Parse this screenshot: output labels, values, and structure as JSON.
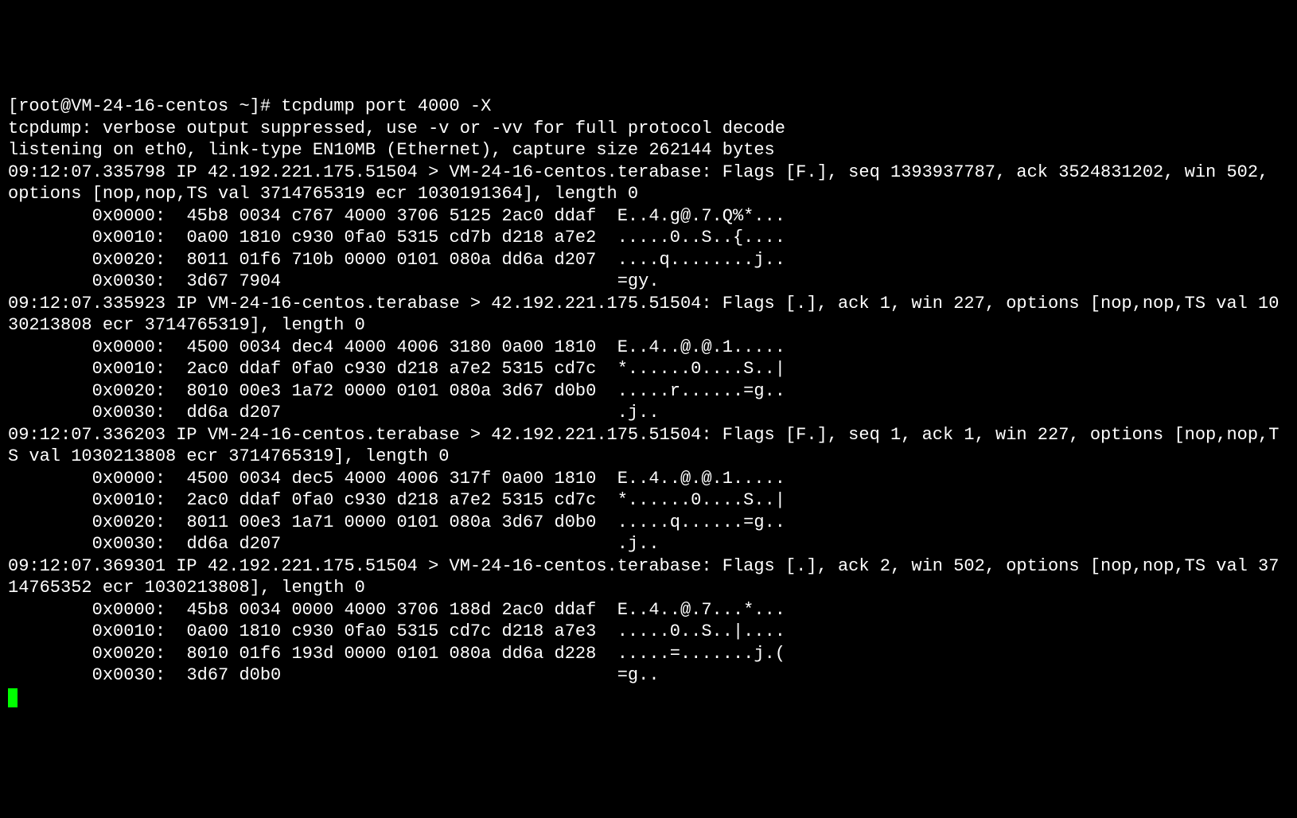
{
  "prompt": {
    "prefix": "[root@VM-24-16-centos ~]# ",
    "command": "tcpdump port 4000 -X"
  },
  "header1": "tcpdump: verbose output suppressed, use -v or -vv for full protocol decode",
  "header2": "listening on eth0, link-type EN10MB (Ethernet), capture size 262144 bytes",
  "packets": [
    {
      "summary": "09:12:07.335798 IP 42.192.221.175.51504 > VM-24-16-centos.terabase: Flags [F.], seq 1393937787, ack 3524831202, win 502, options [nop,nop,TS val 3714765319 ecr 1030191364], length 0",
      "hex": [
        "        0x0000:  45b8 0034 c767 4000 3706 5125 2ac0 ddaf  E..4.g@.7.Q%*...",
        "        0x0010:  0a00 1810 c930 0fa0 5315 cd7b d218 a7e2  .....0..S..{....",
        "        0x0020:  8011 01f6 710b 0000 0101 080a dd6a d207  ....q........j..",
        "        0x0030:  3d67 7904                                =gy."
      ]
    },
    {
      "summary": "09:12:07.335923 IP VM-24-16-centos.terabase > 42.192.221.175.51504: Flags [.], ack 1, win 227, options [nop,nop,TS val 1030213808 ecr 3714765319], length 0",
      "hex": [
        "        0x0000:  4500 0034 dec4 4000 4006 3180 0a00 1810  E..4..@.@.1.....",
        "        0x0010:  2ac0 ddaf 0fa0 c930 d218 a7e2 5315 cd7c  *......0....S..|",
        "        0x0020:  8010 00e3 1a72 0000 0101 080a 3d67 d0b0  .....r......=g..",
        "        0x0030:  dd6a d207                                .j.."
      ]
    },
    {
      "summary": "09:12:07.336203 IP VM-24-16-centos.terabase > 42.192.221.175.51504: Flags [F.], seq 1, ack 1, win 227, options [nop,nop,TS val 1030213808 ecr 3714765319], length 0",
      "hex": [
        "        0x0000:  4500 0034 dec5 4000 4006 317f 0a00 1810  E..4..@.@.1.....",
        "        0x0010:  2ac0 ddaf 0fa0 c930 d218 a7e2 5315 cd7c  *......0....S..|",
        "        0x0020:  8011 00e3 1a71 0000 0101 080a 3d67 d0b0  .....q......=g..",
        "        0x0030:  dd6a d207                                .j.."
      ]
    },
    {
      "summary": "09:12:07.369301 IP 42.192.221.175.51504 > VM-24-16-centos.terabase: Flags [.], ack 2, win 502, options [nop,nop,TS val 3714765352 ecr 1030213808], length 0",
      "hex": [
        "        0x0000:  45b8 0034 0000 4000 3706 188d 2ac0 ddaf  E..4..@.7...*...",
        "        0x0010:  0a00 1810 c930 0fa0 5315 cd7c d218 a7e3  .....0..S..|....",
        "        0x0020:  8010 01f6 193d 0000 0101 080a dd6a d228  .....=.......j.(",
        "        0x0030:  3d67 d0b0                                =g.."
      ]
    }
  ]
}
